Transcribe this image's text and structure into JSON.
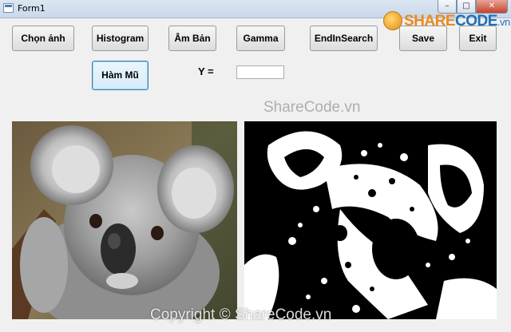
{
  "window": {
    "title": "Form1",
    "minimize": "–",
    "maximize": "□",
    "close": "✕"
  },
  "logo": {
    "share": "SHARE",
    "code": "CODE",
    "vn": ".vn"
  },
  "toolbar": {
    "chon_anh": "Chọn ảnh",
    "histogram": "Histogram",
    "am_ban": "Âm Bản",
    "gamma": "Gamma",
    "endinsearch": "EndInSearch",
    "save": "Save",
    "exit": "Exit",
    "ham_mu": "Hàm Mũ"
  },
  "y_field": {
    "label": "Y =",
    "value": ""
  },
  "watermarks": {
    "middle": "ShareCode.vn",
    "bottom": "Copyright © ShareCode.vn"
  },
  "images": {
    "left": "koala-photo",
    "right": "koala-thresholded"
  }
}
